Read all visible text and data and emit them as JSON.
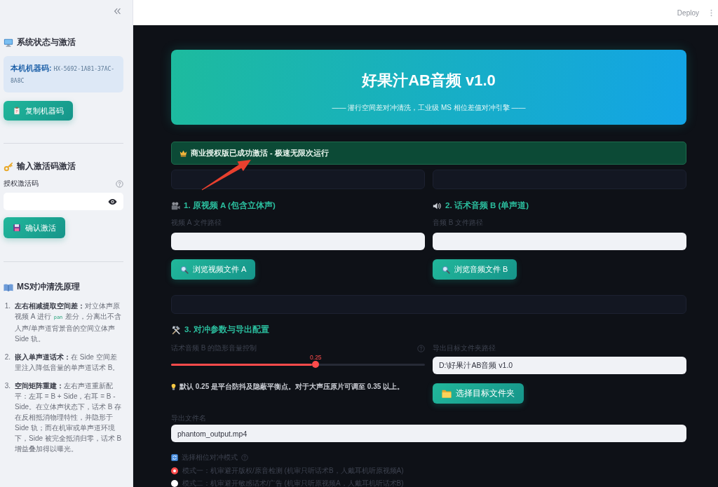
{
  "sidebar": {
    "system": {
      "title": "系统状态与激活",
      "machine_code_label": "本机机器码:",
      "machine_code": "HX-5692-1A81-37AC-8A8C",
      "copy_button": "复制机器码"
    },
    "activation": {
      "title": "输入激活码激活",
      "field_label": "授权激活码",
      "confirm_button": "确认激活"
    },
    "principle": {
      "title": "MS对冲清洗原理",
      "items": [
        {
          "number": "1.",
          "title": "左右相减提取空间差：",
          "segments": [
            {
              "kind": "text",
              "text": "对立体声原视频 A 进行"
            },
            {
              "kind": "code",
              "text": "pan"
            },
            {
              "kind": "text",
              "text": "差分，分离出不含人声/单声道背景音的空间立体声 Side 轨。"
            }
          ]
        },
        {
          "number": "2.",
          "title": "嵌入单声道话术：",
          "segments": [
            {
              "kind": "text",
              "text": "在 Side 空间差里注入降低音量的单声道话术 B。"
            }
          ]
        },
        {
          "number": "3.",
          "title": "空间矩阵重建：",
          "segments": [
            {
              "kind": "text",
              "text": "左右声道重新配平：左耳 = B + Side，右耳 = B - Side。在立体声状态下，话术 B 存在反相抵消物理特性，并隐形于 Side 轨；而在机审或单声道环境下，Side 被完全抵消归零，话术 B 增益叠加得以曝光。"
            }
          ]
        }
      ]
    }
  },
  "header": {
    "deploy": "Deploy"
  },
  "hero": {
    "title": "好果汁AB音频 v1.0",
    "subtitle": "—— 潜行空间差对冲清洗，工业级 MS 相位差值对冲引擎 ——"
  },
  "banner": {
    "text": "商业授权版已成功激活 - 极速无限次运行"
  },
  "sources": [
    {
      "kind": "video",
      "heading": "1. 原视频 A (包含立体声)",
      "label": "视频 A 文件路径",
      "button": "浏览视频文件 A"
    },
    {
      "kind": "audio",
      "heading": "2. 话术音频 B (单声道)",
      "label": "音频 B 文件路径",
      "button": "浏览音频文件 B"
    }
  ],
  "config": {
    "heading": "3. 对冲参数与导出配置",
    "slider": {
      "label": "话术音频 B 的隐形音量控制",
      "reading": "0.25",
      "level": 0.57
    },
    "hint": "默认 0.25 是平台防抖及隐蔽平衡点。对于大声压原片可调至 0.35 以上。",
    "folder": {
      "label": "导出目标文件夹路径",
      "value": "D:\\好果汁AB音频 v1.0",
      "button": "选择目标文件夹"
    },
    "filename": {
      "label": "导出文件名",
      "value": "phantom_output.mp4"
    },
    "mode": {
      "label": "选择相位对冲模式",
      "options": [
        {
          "label": "模式一：机审避开版权/原音检测 (机审只听话术B，人戴耳机听原视频A)",
          "selected": true
        },
        {
          "label": "模式二：机审避开敏感话术/广告 (机审只听原视频A，人戴耳机听话术B)",
          "selected": false
        }
      ]
    }
  }
}
